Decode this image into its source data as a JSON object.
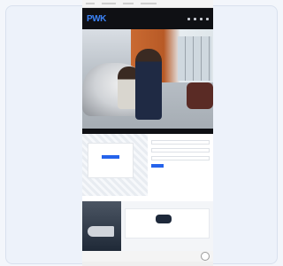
{
  "brand": {
    "logo": "PWK",
    "accent": "#3b82f6"
  },
  "hero": {
    "title": "",
    "subtitle": ""
  },
  "form": {
    "label": "",
    "button": ""
  },
  "promo": {
    "heading": "",
    "button": ""
  },
  "product": {
    "section_title": "",
    "name": ""
  },
  "icons": [
    "menu-icon",
    "search-icon",
    "user-icon",
    "cart-icon",
    "chat-icon"
  ]
}
